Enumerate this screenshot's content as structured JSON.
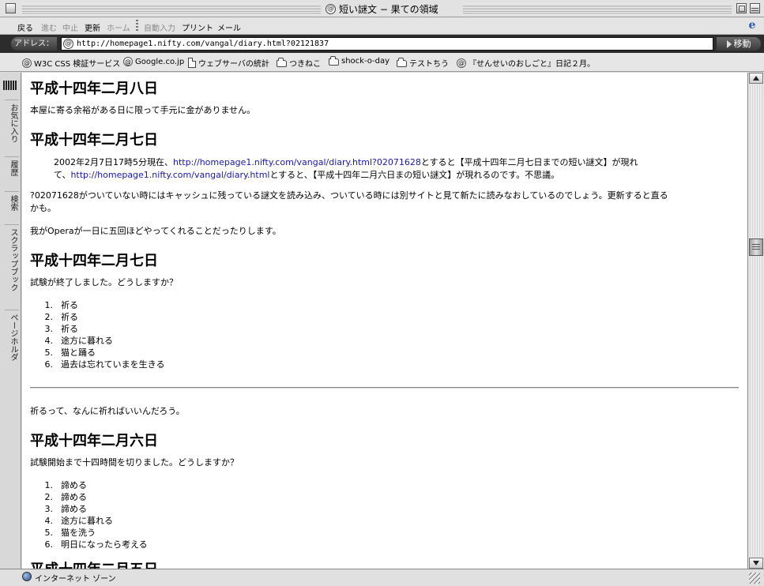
{
  "window": {
    "title": "短い謎文 − 果ての領域"
  },
  "toolbar": {
    "back": "戻る",
    "forward": "進む",
    "stop": "中止",
    "refresh": "更新",
    "home": "ホーム",
    "autofill": "自動入力",
    "print": "プリント",
    "mail": "メール"
  },
  "address": {
    "label": "アドレス：",
    "url": "http://homepage1.nifty.com/vangal/diary.html?02121837",
    "go": "移動"
  },
  "favorites": [
    "W3C CSS 検証サービス",
    "Google.co.jp",
    "ウェブサーバの統計",
    "つきねこ",
    "shock-o-day",
    "テストちう",
    "『せんせいのおしごと』日記２月。"
  ],
  "sidebar": {
    "tabs": [
      "お気に入り",
      "履歴",
      "検索",
      "スクラップブック",
      "ページホルダ"
    ]
  },
  "content": {
    "e1": {
      "heading": "平成十四年二月八日",
      "p1": "本屋に寄る余裕がある日に限って手元に金がありません。"
    },
    "e2": {
      "heading": "平成十四年二月七日",
      "q_a": "2002年2月7日17時5分現在、",
      "q_link1": "http://homepage1.nifty.com/vangal/diary.html?02071628",
      "q_b": "とすると【平成十四年二月七日までの短い謎文】が現れ",
      "q_c": "て、",
      "q_link2": "http://homepage1.nifty.com/vangal/diary.html",
      "q_d": "とすると、【平成十四年二月六日まの短い謎文】が現れるのです。不思議。",
      "p1a": "?02071628がついていない時にはキャッシュに残っている謎文を読み込み、ついている時には別サイトと見て新たに読みなおしているのでしょう。更新すると直る",
      "p1b": "かも。",
      "p2": "我がOperaが一日に五回ほどやってくれることだったりします。"
    },
    "e3": {
      "heading": "平成十四年二月七日",
      "p1": "試験が終了しました。どうしますか？",
      "list": [
        "祈る",
        "祈る",
        "祈る",
        "途方に暮れる",
        "猫と踊る",
        "過去は忘れていまを生きる"
      ],
      "p2": "祈るって、なんに祈ればいいんだろう。"
    },
    "e4": {
      "heading": "平成十四年二月六日",
      "p1": "試験開始まで十四時間を切りました。どうしますか？",
      "list": [
        "諦める",
        "諦める",
        "諦める",
        "途方に暮れる",
        "猫を洗う",
        "明日になったら考える"
      ]
    },
    "e5": {
      "heading": "平成十四年二月五日"
    }
  },
  "status": {
    "zone": "インターネット ゾーン"
  }
}
